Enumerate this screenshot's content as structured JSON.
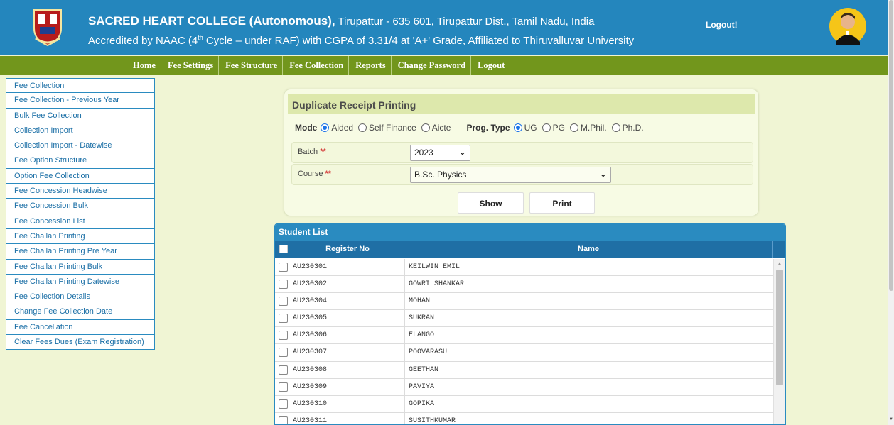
{
  "header": {
    "college_name": "SACRED HEART COLLEGE (Autonomous),",
    "address": " Tirupattur - 635 601, Tirupattur Dist., Tamil Nadu, India",
    "accreditation_pre": "Accredited by NAAC (4",
    "accreditation_sup": "th",
    "accreditation_post": " Cycle – under RAF) with CGPA of 3.31/4 at 'A+' Grade, Affiliated to Thiruvalluvar University",
    "logout_label": "Logout!"
  },
  "nav": {
    "items": [
      "Home",
      "Fee Settings",
      "Fee Structure",
      "Fee Collection",
      "Reports",
      "Change Password",
      "Logout"
    ]
  },
  "sidebar": {
    "items": [
      "Fee Collection",
      "Fee Collection - Previous Year",
      "Bulk Fee Collection",
      "Collection Import",
      "Collection Import - Datewise",
      "Fee Option Structure",
      "Option Fee Collection",
      "Fee Concession Headwise",
      "Fee Concession Bulk",
      "Fee Concession List",
      "Fee Challan Printing",
      "Fee Challan Printing Pre Year",
      "Fee Challan Printing Bulk",
      "Fee Challan Printing Datewise",
      "Fee Collection Details",
      "Change Fee Collection Date",
      "Fee Cancellation",
      "Clear Fees Dues (Exam Registration)"
    ]
  },
  "panel": {
    "title": "Duplicate Receipt Printing",
    "mode_label": "Mode",
    "mode_options": [
      "Aided",
      "Self Finance",
      "Aicte"
    ],
    "mode_selected": "Aided",
    "prog_label": "Prog. Type",
    "prog_options": [
      "UG",
      "PG",
      "M.Phil.",
      "Ph.D."
    ],
    "prog_selected": "UG",
    "batch_label": "Batch",
    "batch_value": "2023",
    "course_label": "Course",
    "course_value": "B.Sc. Physics",
    "required_marker": "**",
    "show_label": "Show",
    "print_label": "Print"
  },
  "student_list": {
    "title": "Student List",
    "columns": [
      "Register No",
      "Name"
    ],
    "rows": [
      {
        "reg": "AU230301",
        "name": "KEILWIN EMIL"
      },
      {
        "reg": "AU230302",
        "name": "GOWRI SHANKAR"
      },
      {
        "reg": "AU230304",
        "name": "MOHAN"
      },
      {
        "reg": "AU230305",
        "name": "SUKRAN"
      },
      {
        "reg": "AU230306",
        "name": "ELANGO"
      },
      {
        "reg": "AU230307",
        "name": "POOVARASU"
      },
      {
        "reg": "AU230308",
        "name": "GEETHAN"
      },
      {
        "reg": "AU230309",
        "name": "PAVIYA"
      },
      {
        "reg": "AU230310",
        "name": "GOPIKA"
      },
      {
        "reg": "AU230311",
        "name": "SUSITHKUMAR"
      }
    ]
  },
  "colors": {
    "header_bg": "#2486bd",
    "nav_bg": "#72961c",
    "page_bg": "#f0f5d4",
    "table_head": "#1f6fa5"
  }
}
